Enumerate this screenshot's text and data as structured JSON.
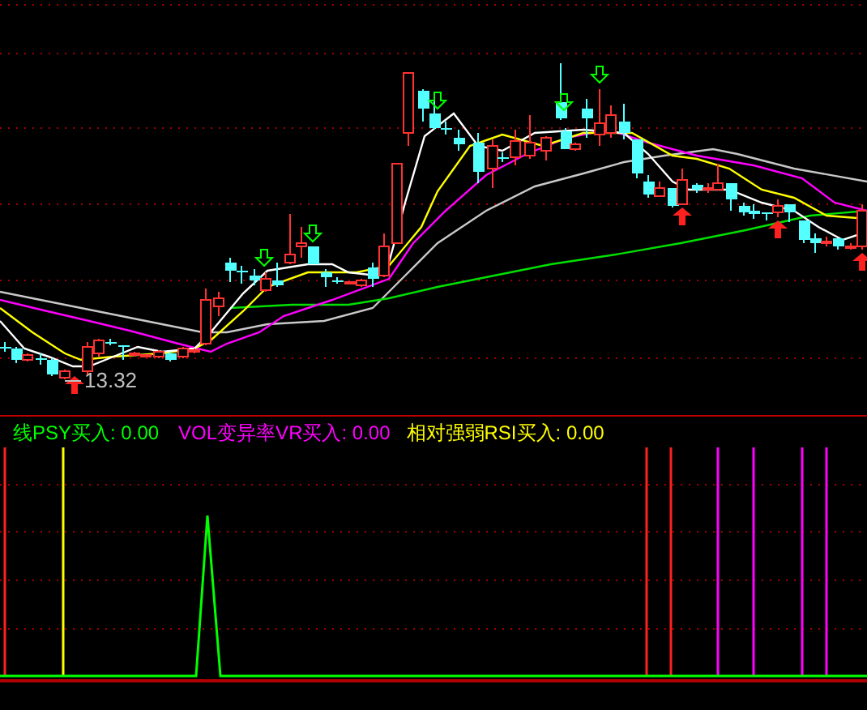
{
  "price_chart": {
    "low_price_label": "13.32"
  },
  "indicator_legend": [
    {
      "text": "线PSY买入: 0.00",
      "color": "#00ff00"
    },
    {
      "text": "VOL变异率VR买入: 0.00",
      "color": "#ff00ff"
    },
    {
      "text": "相对强弱RSI买入: 0.00",
      "color": "#ffff00"
    }
  ]
}
